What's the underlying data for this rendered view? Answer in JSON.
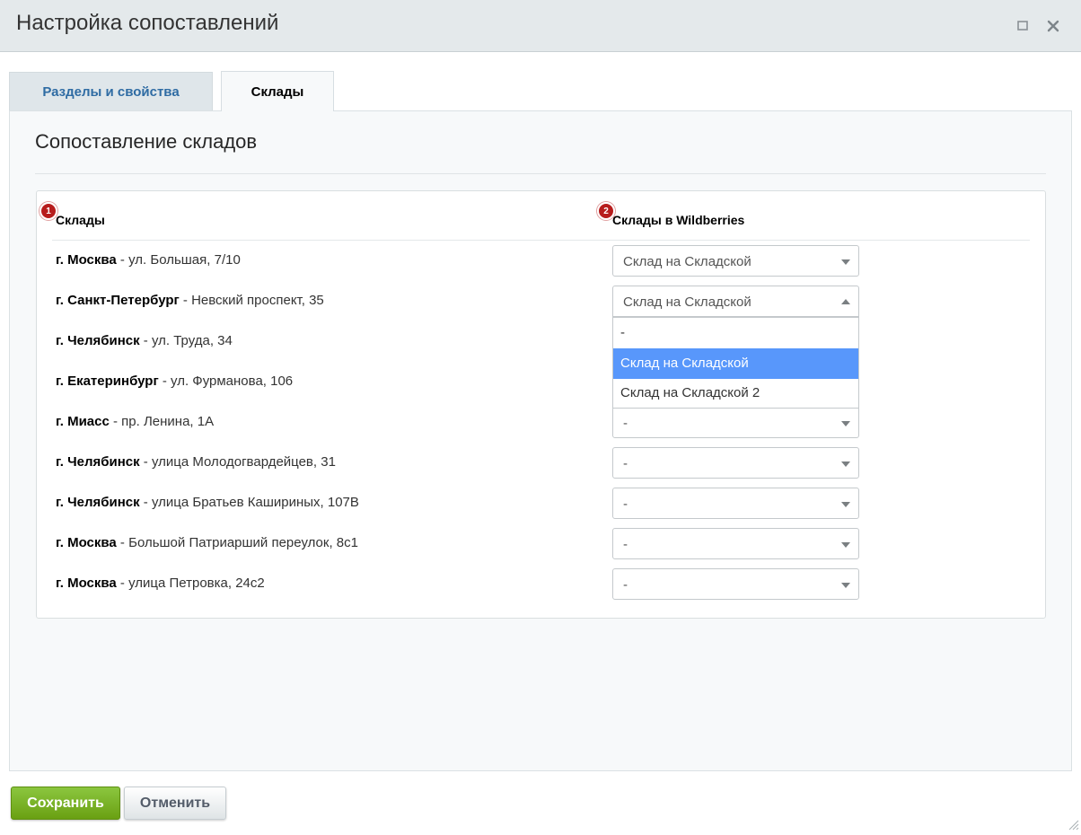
{
  "window": {
    "title": "Настройка сопоставлений"
  },
  "tabs": [
    {
      "label": "Разделы и свойства",
      "active": false
    },
    {
      "label": "Склады",
      "active": true
    }
  ],
  "panel": {
    "title": "Сопоставление складов"
  },
  "table": {
    "badges": [
      "1",
      "2"
    ],
    "col1_header": "Склады",
    "col2_header": "Склады в Wildberries",
    "rows": [
      {
        "city": "г. Москва",
        "address": " - ул. Большая, 7/10",
        "select_value": "Склад на Складской",
        "open": false
      },
      {
        "city": "г. Санкт-Петербург",
        "address": " - Невский проспект, 35",
        "select_value": "Склад на Складской",
        "open": true
      },
      {
        "city": "г. Челябинск",
        "address": " - ул. Труда, 34",
        "select_value": "",
        "open": false
      },
      {
        "city": "г. Екатеринбург",
        "address": " - ул. Фурманова, 106",
        "select_value": "",
        "open": false
      },
      {
        "city": "г. Миасс",
        "address": " - пр. Ленина, 1А",
        "select_value": "-",
        "open": false
      },
      {
        "city": "г. Челябинск",
        "address": " - улица Молодогвардейцев, 31",
        "select_value": "-",
        "open": false
      },
      {
        "city": "г. Челябинск",
        "address": " - улица Братьев Кашириных, 107В",
        "select_value": "-",
        "open": false
      },
      {
        "city": "г. Москва",
        "address": " - Большой Патриарший переулок, 8с1",
        "select_value": "-",
        "open": false
      },
      {
        "city": "г. Москва",
        "address": " - улица Петровка, 24с2",
        "select_value": "-",
        "open": false
      }
    ],
    "dropdown_options": [
      {
        "label": "-",
        "selected": false
      },
      {
        "label": "Склад на Складской",
        "selected": true
      },
      {
        "label": "Склад на Складской 2",
        "selected": false
      }
    ]
  },
  "footer": {
    "save_label": "Сохранить",
    "cancel_label": "Отменить"
  },
  "colors": {
    "accent_green": "#7ab62a",
    "selected_option": "#5897fb",
    "badge_red": "#b71c1c",
    "tab_link": "#2e6ba3"
  }
}
